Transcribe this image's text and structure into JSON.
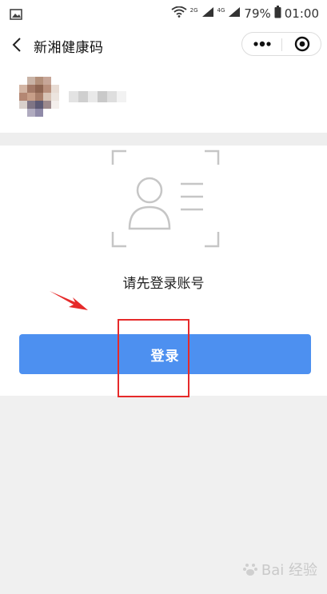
{
  "status_bar": {
    "network_top": "2G",
    "network_bottom": "4G",
    "battery": "79%",
    "time": "01:00",
    "icons": [
      "gallery-icon",
      "wifi-icon",
      "signal-icon",
      "battery-icon"
    ]
  },
  "nav": {
    "title": "新湘健康码",
    "icons": [
      "back-arrow-icon",
      "more-dots-icon",
      "close-target-icon"
    ]
  },
  "user": {
    "avatar_state": "pixelated",
    "name_state": "pixelated"
  },
  "login": {
    "prompt": "请先登录账号",
    "button_label": "登录",
    "icon": "id-card-person-icon",
    "accent_color": "#4d90f0"
  },
  "annotation": {
    "arrow_color": "#e62a2a",
    "box_color": "#e62a2a"
  },
  "watermark": {
    "text": "Bai 经验"
  }
}
